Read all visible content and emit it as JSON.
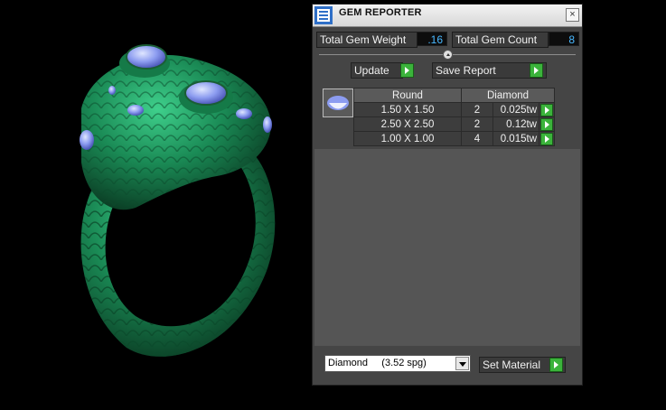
{
  "app": {
    "title": "GEM REPORTER",
    "close_glyph": "×",
    "icon": "gem-reporter-app-icon"
  },
  "summary": {
    "weight_label": "Total Gem Weight",
    "weight_value": ".16",
    "count_label": "Total Gem Count",
    "count_value": "8"
  },
  "actions": {
    "update_label": "Update",
    "save_label": "Save Report"
  },
  "table": {
    "headers": [
      "Round",
      "Diamond"
    ],
    "rows": [
      {
        "size": "1.50 X 1.50",
        "count": "2",
        "weight": "0.025tw"
      },
      {
        "size": "2.50 X 2.50",
        "count": "2",
        "weight": "0.12tw"
      },
      {
        "size": "1.00 X 1.00",
        "count": "4",
        "weight": "0.015tw"
      }
    ]
  },
  "material": {
    "selected": "Diamond     (3.52 spg)",
    "set_label": "Set Material"
  },
  "colors": {
    "accent": "#3bb33b",
    "value_text": "#49b8ff",
    "panel": "#454545",
    "ring": "#1e8a55",
    "gem": "#8c9cf0"
  }
}
